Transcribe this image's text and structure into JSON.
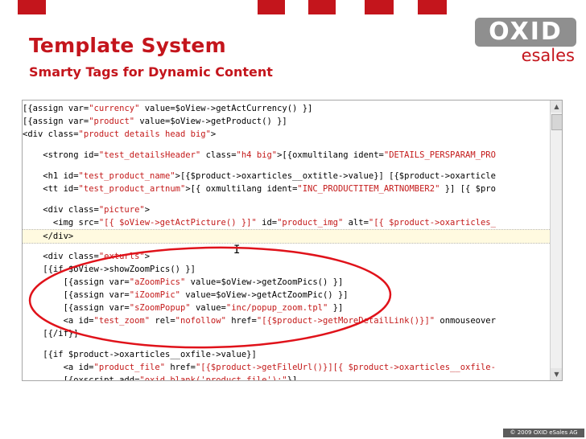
{
  "slide": {
    "title": "Template System",
    "subtitle": "Smarty Tags for Dynamic Content",
    "logo_top": "OXID",
    "logo_bottom": "esales",
    "copyright": "© 2009 OXID eSales AG",
    "accent_color": "#c4151c"
  },
  "code": {
    "lines": [
      {
        "segs": [
          "[{assign var=",
          "\"currency\"",
          " value=$oView->getActCurrency() }]"
        ]
      },
      {
        "segs": [
          "[{assign var=",
          "\"product\"",
          " value=$oView->getProduct() }]"
        ]
      },
      {
        "segs": [
          "<div class=",
          "\"product details head big\"",
          ">"
        ]
      },
      {
        "segs": [
          ""
        ]
      },
      {
        "segs": [
          "    <strong id=",
          "\"test_detailsHeader\"",
          " class=",
          "\"h4 big\"",
          ">[{oxmultilang ident=",
          "\"DETAILS_PERSPARAM_PRO"
        ]
      },
      {
        "segs": [
          ""
        ]
      },
      {
        "segs": [
          "    <h1 id=",
          "\"test_product_name\"",
          ">[{$product->oxarticles__oxtitle->value}] [{$product->oxarticle"
        ]
      },
      {
        "segs": [
          "    <tt id=",
          "\"test_product_artnum\"",
          ">[{ oxmultilang ident=",
          "\"INC_PRODUCTITEM_ARTNOMBER2\"",
          " }] [{ $pro"
        ]
      },
      {
        "segs": [
          ""
        ]
      },
      {
        "segs": [
          "    <div class=",
          "\"picture\"",
          ">"
        ]
      },
      {
        "segs": [
          "      <img src=",
          "\"[{ $oView->getActPicture() }]\"",
          " id=",
          "\"product_img\"",
          " alt=",
          "\"[{ $product->oxarticles_"
        ]
      },
      {
        "segs": [
          "    </div>"
        ]
      },
      {
        "segs": [
          ""
        ]
      },
      {
        "segs": [
          "    <div class=",
          "\"exturls\"",
          ">"
        ]
      },
      {
        "segs": [
          "    [{if $oView->showZoomPics() }]"
        ]
      },
      {
        "segs": [
          "        [{assign var=",
          "\"aZoomPics\"",
          " value=$oView->getZoomPics() }]"
        ]
      },
      {
        "segs": [
          "        [{assign var=",
          "\"iZoomPic\"",
          " value=$oView->getActZoomPic() }]"
        ]
      },
      {
        "segs": [
          "        [{assign var=",
          "\"sZoomPopup\"",
          " value=",
          "\"inc/popup_zoom.tpl\"",
          " }]"
        ]
      },
      {
        "segs": [
          "        <a id=",
          "\"test_zoom\"",
          " rel=",
          "\"nofollow\"",
          " href=",
          "\"[{$product->getMoreDetailLink()}]\"",
          " onmouseover"
        ]
      },
      {
        "segs": [
          "    [{/if}]"
        ]
      },
      {
        "segs": [
          ""
        ]
      },
      {
        "segs": [
          "    [{if $product->oxarticles__oxfile->value}]"
        ]
      },
      {
        "segs": [
          "        <a id=",
          "\"product_file\"",
          " href=",
          "\"[{$product->getFileUrl()}][{ $product->oxarticles__oxfile-"
        ]
      },
      {
        "segs": [
          "        [{oxscript add=",
          "\"oxid.blank('product_file');\"",
          "}]"
        ]
      }
    ]
  },
  "scrollbar": {
    "up_icon": "triangle-up",
    "down_icon": "triangle-down"
  }
}
